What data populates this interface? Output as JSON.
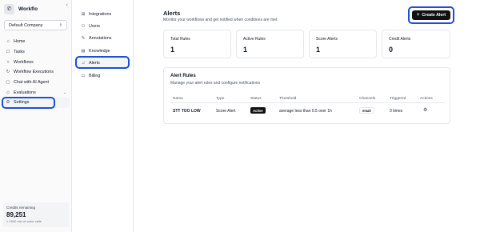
{
  "brand": {
    "name": "Workflo"
  },
  "company": {
    "selected": "Default Company"
  },
  "sidebar": {
    "items": [
      {
        "label": "Home",
        "icon": "home-icon"
      },
      {
        "label": "Tasks",
        "icon": "tasks-icon"
      },
      {
        "label": "Workflows",
        "icon": "workflows-icon"
      },
      {
        "label": "Workflow Executions",
        "icon": "executions-icon"
      },
      {
        "label": "Chat with AI Agent",
        "icon": "chat-icon"
      },
      {
        "label": "Evaluations",
        "icon": "evaluations-icon"
      },
      {
        "label": "Settings",
        "icon": "gear-icon"
      }
    ]
  },
  "credits": {
    "label": "Credits remaining",
    "value": "89,251",
    "sub": "≈ 1562 min of voice calls"
  },
  "settings_nav": {
    "items": [
      {
        "label": "Integrations"
      },
      {
        "label": "Users"
      },
      {
        "label": "Annotations"
      },
      {
        "label": "Knowledge"
      },
      {
        "label": "Alerts"
      },
      {
        "label": "Billing"
      }
    ]
  },
  "header": {
    "title": "Alerts",
    "subtitle": "Monitor your workflows and get notified when conditions are met",
    "create_label": "Create Alert"
  },
  "stats": [
    {
      "label": "Total Rules",
      "value": "1"
    },
    {
      "label": "Active Rules",
      "value": "1"
    },
    {
      "label": "Score Alerts",
      "value": "1"
    },
    {
      "label": "Credit Alerts",
      "value": "0"
    }
  ],
  "rules": {
    "title": "Alert Rules",
    "subtitle": "Manage your alert rules and configure notifications",
    "columns": [
      "Name",
      "Type",
      "Status",
      "Threshold",
      "Channels",
      "Triggered",
      "Actions"
    ],
    "rows": [
      {
        "name": "STT TOO LOW",
        "type": "Score Alert",
        "status": "Active",
        "threshold": "average less than 0.5 over 1h",
        "channel": "email",
        "triggered": "0 times"
      }
    ]
  },
  "colors": {
    "accent": "#1d4ed8",
    "button": "#111111"
  }
}
